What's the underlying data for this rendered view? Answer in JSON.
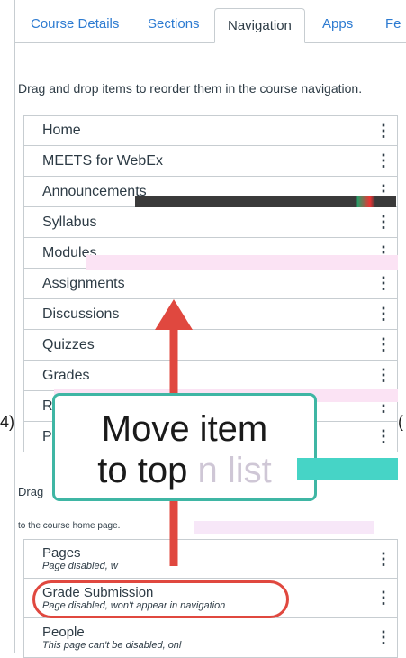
{
  "tabs": [
    {
      "label": "Course Details"
    },
    {
      "label": "Sections"
    },
    {
      "label": "Navigation",
      "active": true
    },
    {
      "label": "Apps"
    },
    {
      "label": "Fe"
    }
  ],
  "instructions": "Drag and drop items to reorder them in the course navigation.",
  "enabled_items": [
    {
      "label": "Home"
    },
    {
      "label": "MEETS for WebEx"
    },
    {
      "label": "Announcements"
    },
    {
      "label": "Syllabus"
    },
    {
      "label": "Modules"
    },
    {
      "label": "Assignments"
    },
    {
      "label": "Discussions"
    },
    {
      "label": "Quizzes"
    },
    {
      "label": "Grades"
    },
    {
      "label": "R"
    },
    {
      "label": "P"
    }
  ],
  "drag_hint": "Drag",
  "drag_hint2": "to the course home page.",
  "disabled_items": [
    {
      "label": "Pages",
      "sub": "Page disabled, w"
    },
    {
      "label": "Grade Submission",
      "sub": "Page disabled, won't appear in navigation"
    },
    {
      "label": "People",
      "sub": "This page can't be disabled, onl"
    }
  ],
  "callout": {
    "line1": "Move item",
    "line2": "to top",
    "line2b": "n list"
  },
  "side_left": "4)",
  "side_right": "("
}
